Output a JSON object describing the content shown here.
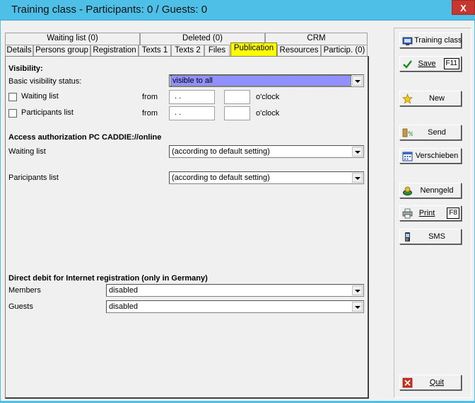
{
  "window": {
    "title": "Training class - Participants: 0 / Guests: 0",
    "close_glyph": "X"
  },
  "tabs_top": [
    {
      "label": "Waiting list (0)"
    },
    {
      "label": "Deleted (0)"
    },
    {
      "label": "CRM"
    }
  ],
  "tabs_bottom": [
    {
      "label": "Details"
    },
    {
      "label": "Persons group"
    },
    {
      "label": "Registration"
    },
    {
      "label": "Texts 1"
    },
    {
      "label": "Texts 2"
    },
    {
      "label": "Files"
    },
    {
      "label": "Publication",
      "active": true
    },
    {
      "label": "Resources"
    },
    {
      "label": "Particip. (0)"
    }
  ],
  "visibility": {
    "heading": "Visibility:",
    "basic_label": "Basic visibility status:",
    "basic_value": "visible to all",
    "waiting_label": "Waiting list",
    "participants_label": "Participants list",
    "from_label": "from",
    "date_placeholder": " .  .",
    "oclock_label": "o'clock"
  },
  "access": {
    "heading": "Access authorization PC CADDIE://online",
    "waiting_label": "Waiting list",
    "waiting_value": "(according to default setting)",
    "participants_label": "Paricipants list",
    "participants_value": "(according to default setting)"
  },
  "debit": {
    "heading": "Direct debit for Internet registration (only in Germany)",
    "members_label": "Members",
    "members_value": "disabled",
    "guests_label": "Guests",
    "guests_value": "disabled"
  },
  "side_buttons": {
    "training_class": {
      "label": "Training class",
      "icon": "training-class-icon"
    },
    "save": {
      "label": "Save",
      "key": "F11",
      "icon": "check-icon"
    },
    "new": {
      "label": "New",
      "icon": "star-icon"
    },
    "send": {
      "label": "Send",
      "icon": "send-icon"
    },
    "verschieben": {
      "label": "Verschieben",
      "icon": "calendar-icon"
    },
    "nenngeld": {
      "label": "Nenngeld",
      "icon": "money-icon"
    },
    "print": {
      "label": "Print",
      "key": "F8",
      "icon": "printer-icon"
    },
    "sms": {
      "label": "SMS",
      "icon": "phone-icon"
    },
    "quit": {
      "label": "Quit",
      "icon": "close-icon"
    }
  },
  "colors": {
    "titlebar": "#4ec0e8",
    "active_tab": "#ffff00",
    "selected_value": "#9090ff",
    "close_button": "#c7372f"
  }
}
